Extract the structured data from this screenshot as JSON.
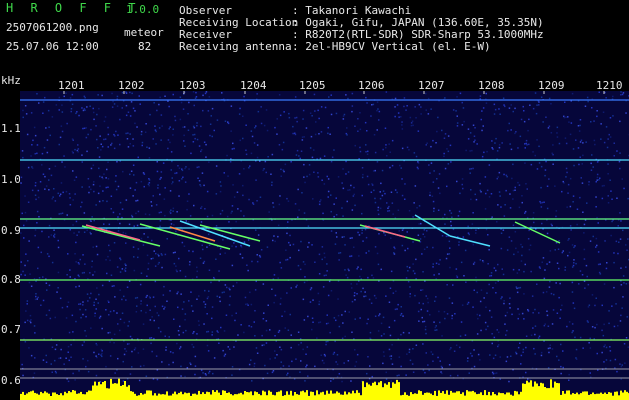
{
  "header": {
    "app_title": "H R O F F T",
    "app_version": "1.0.0",
    "file_name": "2507061200.png",
    "datetime": "25.07.06 12:00",
    "meteor_label": "meteor",
    "meteor_count": "82",
    "info_rows": [
      {
        "key": "Observer",
        "value": ": Takanori Kawachi"
      },
      {
        "key": "Receiving Location",
        "value": ": Ogaki, Gifu, JAPAN (136.60E, 35.35N)"
      },
      {
        "key": "Receiver",
        "value": ": R820T2(RTL-SDR) SDR-Sharp 53.1000MHz"
      },
      {
        "key": "Receiving antenna",
        "value": ": 2el-HB9CV Vertical (el. E-W)"
      }
    ]
  },
  "spectrogram": {
    "y_unit": "kHz",
    "x_ticks": [
      "1201",
      "1202",
      "1203",
      "1204",
      "1205",
      "1206",
      "1207",
      "1208",
      "1209",
      "1210"
    ],
    "y_ticks": [
      "1.1",
      "1.0",
      "0.9",
      "0.8",
      "0.7",
      "0.6"
    ],
    "colors": {
      "background": "#06063a",
      "noise": "#1a2a9a",
      "line": "#4fe0ff",
      "trail": "#66ff66",
      "bottom": "#ffff00"
    }
  }
}
